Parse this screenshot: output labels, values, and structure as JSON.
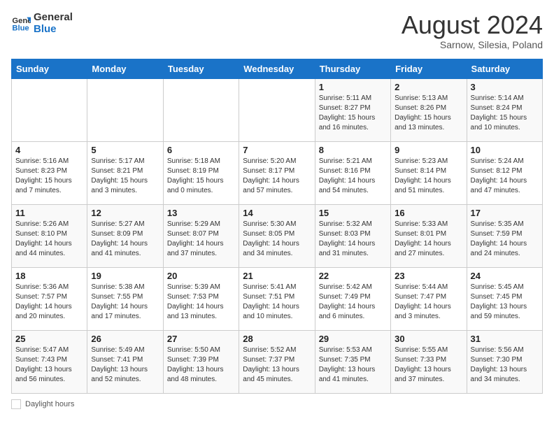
{
  "logo": {
    "line1": "General",
    "line2": "Blue"
  },
  "title": "August 2024",
  "subtitle": "Sarnow, Silesia, Poland",
  "days_of_week": [
    "Sunday",
    "Monday",
    "Tuesday",
    "Wednesday",
    "Thursday",
    "Friday",
    "Saturday"
  ],
  "weeks": [
    [
      {
        "day": "",
        "info": ""
      },
      {
        "day": "",
        "info": ""
      },
      {
        "day": "",
        "info": ""
      },
      {
        "day": "",
        "info": ""
      },
      {
        "day": "1",
        "info": "Sunrise: 5:11 AM\nSunset: 8:27 PM\nDaylight: 15 hours\nand 16 minutes."
      },
      {
        "day": "2",
        "info": "Sunrise: 5:13 AM\nSunset: 8:26 PM\nDaylight: 15 hours\nand 13 minutes."
      },
      {
        "day": "3",
        "info": "Sunrise: 5:14 AM\nSunset: 8:24 PM\nDaylight: 15 hours\nand 10 minutes."
      }
    ],
    [
      {
        "day": "4",
        "info": "Sunrise: 5:16 AM\nSunset: 8:23 PM\nDaylight: 15 hours\nand 7 minutes."
      },
      {
        "day": "5",
        "info": "Sunrise: 5:17 AM\nSunset: 8:21 PM\nDaylight: 15 hours\nand 3 minutes."
      },
      {
        "day": "6",
        "info": "Sunrise: 5:18 AM\nSunset: 8:19 PM\nDaylight: 15 hours\nand 0 minutes."
      },
      {
        "day": "7",
        "info": "Sunrise: 5:20 AM\nSunset: 8:17 PM\nDaylight: 14 hours\nand 57 minutes."
      },
      {
        "day": "8",
        "info": "Sunrise: 5:21 AM\nSunset: 8:16 PM\nDaylight: 14 hours\nand 54 minutes."
      },
      {
        "day": "9",
        "info": "Sunrise: 5:23 AM\nSunset: 8:14 PM\nDaylight: 14 hours\nand 51 minutes."
      },
      {
        "day": "10",
        "info": "Sunrise: 5:24 AM\nSunset: 8:12 PM\nDaylight: 14 hours\nand 47 minutes."
      }
    ],
    [
      {
        "day": "11",
        "info": "Sunrise: 5:26 AM\nSunset: 8:10 PM\nDaylight: 14 hours\nand 44 minutes."
      },
      {
        "day": "12",
        "info": "Sunrise: 5:27 AM\nSunset: 8:09 PM\nDaylight: 14 hours\nand 41 minutes."
      },
      {
        "day": "13",
        "info": "Sunrise: 5:29 AM\nSunset: 8:07 PM\nDaylight: 14 hours\nand 37 minutes."
      },
      {
        "day": "14",
        "info": "Sunrise: 5:30 AM\nSunset: 8:05 PM\nDaylight: 14 hours\nand 34 minutes."
      },
      {
        "day": "15",
        "info": "Sunrise: 5:32 AM\nSunset: 8:03 PM\nDaylight: 14 hours\nand 31 minutes."
      },
      {
        "day": "16",
        "info": "Sunrise: 5:33 AM\nSunset: 8:01 PM\nDaylight: 14 hours\nand 27 minutes."
      },
      {
        "day": "17",
        "info": "Sunrise: 5:35 AM\nSunset: 7:59 PM\nDaylight: 14 hours\nand 24 minutes."
      }
    ],
    [
      {
        "day": "18",
        "info": "Sunrise: 5:36 AM\nSunset: 7:57 PM\nDaylight: 14 hours\nand 20 minutes."
      },
      {
        "day": "19",
        "info": "Sunrise: 5:38 AM\nSunset: 7:55 PM\nDaylight: 14 hours\nand 17 minutes."
      },
      {
        "day": "20",
        "info": "Sunrise: 5:39 AM\nSunset: 7:53 PM\nDaylight: 14 hours\nand 13 minutes."
      },
      {
        "day": "21",
        "info": "Sunrise: 5:41 AM\nSunset: 7:51 PM\nDaylight: 14 hours\nand 10 minutes."
      },
      {
        "day": "22",
        "info": "Sunrise: 5:42 AM\nSunset: 7:49 PM\nDaylight: 14 hours\nand 6 minutes."
      },
      {
        "day": "23",
        "info": "Sunrise: 5:44 AM\nSunset: 7:47 PM\nDaylight: 14 hours\nand 3 minutes."
      },
      {
        "day": "24",
        "info": "Sunrise: 5:45 AM\nSunset: 7:45 PM\nDaylight: 13 hours\nand 59 minutes."
      }
    ],
    [
      {
        "day": "25",
        "info": "Sunrise: 5:47 AM\nSunset: 7:43 PM\nDaylight: 13 hours\nand 56 minutes."
      },
      {
        "day": "26",
        "info": "Sunrise: 5:49 AM\nSunset: 7:41 PM\nDaylight: 13 hours\nand 52 minutes."
      },
      {
        "day": "27",
        "info": "Sunrise: 5:50 AM\nSunset: 7:39 PM\nDaylight: 13 hours\nand 48 minutes."
      },
      {
        "day": "28",
        "info": "Sunrise: 5:52 AM\nSunset: 7:37 PM\nDaylight: 13 hours\nand 45 minutes."
      },
      {
        "day": "29",
        "info": "Sunrise: 5:53 AM\nSunset: 7:35 PM\nDaylight: 13 hours\nand 41 minutes."
      },
      {
        "day": "30",
        "info": "Sunrise: 5:55 AM\nSunset: 7:33 PM\nDaylight: 13 hours\nand 37 minutes."
      },
      {
        "day": "31",
        "info": "Sunrise: 5:56 AM\nSunset: 7:30 PM\nDaylight: 13 hours\nand 34 minutes."
      }
    ]
  ],
  "legend": {
    "label": "Daylight hours"
  }
}
